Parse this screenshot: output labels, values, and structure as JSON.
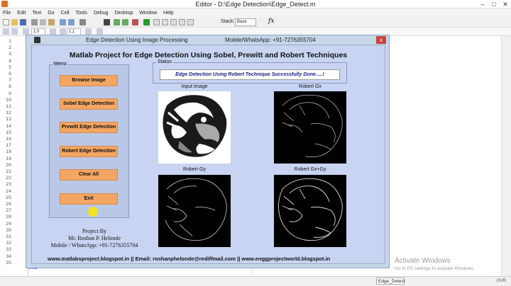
{
  "editor": {
    "title": "Editor - D:\\Edge Detection\\Edge_Detect.m",
    "menus": [
      "File",
      "Edit",
      "Text",
      "Go",
      "Cell",
      "Tools",
      "Debug",
      "Desktop",
      "Window",
      "Help"
    ],
    "stack_label": "Stack:",
    "stack_value": "Base",
    "fx_label": "fx",
    "cell_step_1": "1.0",
    "cell_step_2": "1.1",
    "line_numbers": [
      "1",
      "2",
      "3",
      "4",
      "5",
      "6",
      "7",
      "8",
      "9",
      "10",
      "11",
      "12",
      "13",
      "14",
      "15",
      "16",
      "17",
      "18",
      "19",
      "20",
      "21",
      "22",
      "23",
      "24",
      "25",
      "26",
      "27",
      "28",
      "29",
      "30",
      "31",
      "32",
      "33",
      "34",
      "35"
    ],
    "end_keyword": "end",
    "tab_name": "Edge_Detect",
    "status_mode": "OVR",
    "activation": {
      "title": "Activate Windows",
      "subtitle": "Go to PC settings to activate Windows."
    }
  },
  "figure": {
    "title": "Edge Detection Using Image Processing",
    "contact": "Mobile/WhatsApp: +91-7276355704",
    "close_symbol": "x",
    "main_title": "Matlab Project for Edge Detection Using Sobel, Prewitt and Robert Techniques",
    "menu": {
      "legend": "Menu",
      "buttons": [
        "Browse Image",
        "Sobel Edge Detection",
        "Prewitt Edge Detection",
        "Robert Edge Detection",
        "Clear All",
        "Exit"
      ]
    },
    "status": {
      "legend": "Status",
      "message": "Edge Detection Using Robert Technique Successfully Done.....!"
    },
    "images": {
      "input_label": "Input Image",
      "gx_label": "Robert Gx",
      "gy_label": "Robert Gy",
      "gxgy_label": "Robert Gx+Gy"
    },
    "credits": {
      "line1": "Project By",
      "line2": "Mr. Roshan P. Helonde",
      "line3": "Mobile / WhatsApp: +91-7276355704"
    },
    "footer": "www.matlabsproject.blogspot.in || Email: roshanphelonde@rediffmail.com || www.enggprojectworld.blogspot.in"
  },
  "colors": {
    "button": "#f3a664",
    "panel": "#bac8e8",
    "figure_bg": "#c8d4f2",
    "status_text": "#1a1a8a"
  }
}
